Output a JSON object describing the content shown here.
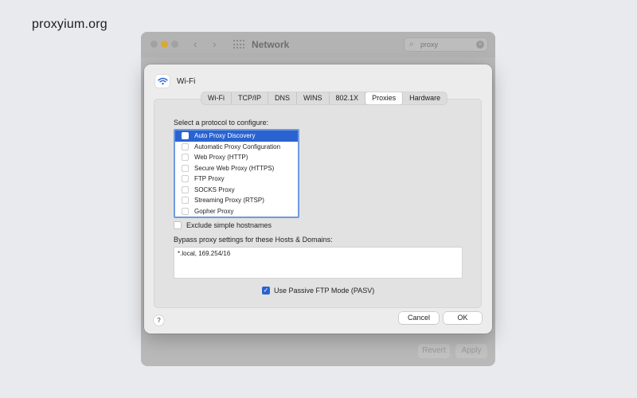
{
  "brand": "proxyium.org",
  "background_window": {
    "title": "Network",
    "search_value": "proxy",
    "revert_label": "Revert",
    "apply_label": "Apply",
    "accent": "#d8a93a"
  },
  "sheet": {
    "title": "Wi-Fi",
    "tabs": [
      {
        "label": "Wi-Fi"
      },
      {
        "label": "TCP/IP"
      },
      {
        "label": "DNS"
      },
      {
        "label": "WINS"
      },
      {
        "label": "802.1X"
      },
      {
        "label": "Proxies",
        "active": true
      },
      {
        "label": "Hardware"
      }
    ],
    "protocol_label": "Select a protocol to configure:",
    "protocols": [
      {
        "label": "Auto Proxy Discovery",
        "selected": true,
        "checked": false
      },
      {
        "label": "Automatic Proxy Configuration",
        "checked": false
      },
      {
        "label": "Web Proxy (HTTP)",
        "checked": false
      },
      {
        "label": "Secure Web Proxy (HTTPS)",
        "checked": false
      },
      {
        "label": "FTP Proxy",
        "checked": false
      },
      {
        "label": "SOCKS Proxy",
        "checked": false
      },
      {
        "label": "Streaming Proxy (RTSP)",
        "checked": false
      },
      {
        "label": "Gopher Proxy",
        "checked": false
      }
    ],
    "exclude_label": "Exclude simple hostnames",
    "exclude_checked": false,
    "bypass_label": "Bypass proxy settings for these Hosts & Domains:",
    "bypass_value": "*.local, 169.254/16",
    "pasv_label": "Use Passive FTP Mode (PASV)",
    "pasv_checked": true,
    "help_label": "?",
    "cancel_label": "Cancel",
    "ok_label": "OK",
    "accent": "#2a63d1"
  }
}
